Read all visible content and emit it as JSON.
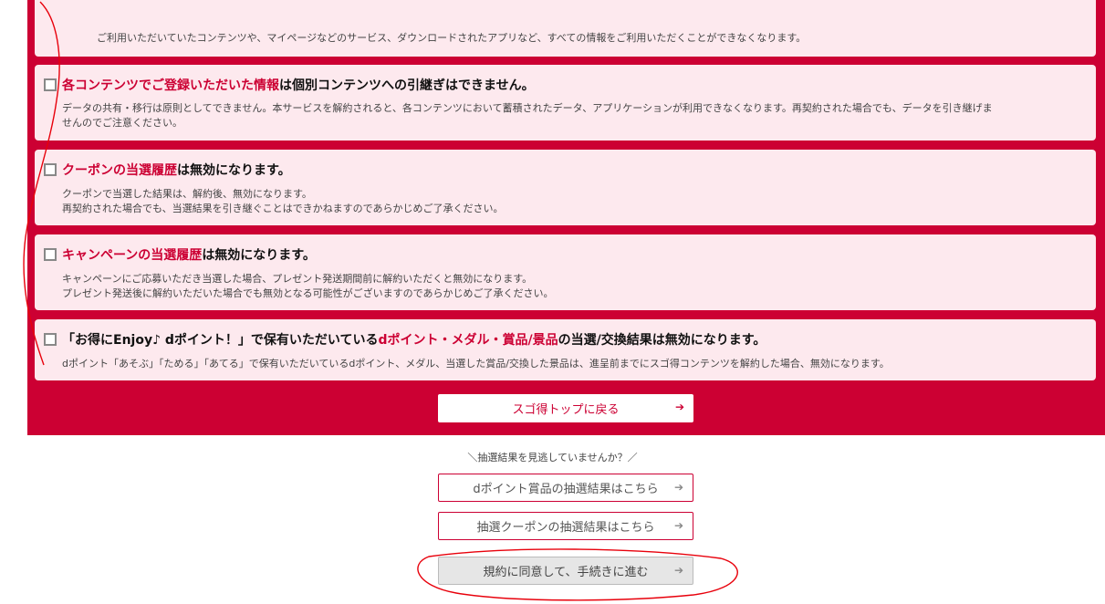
{
  "top_card": {
    "text": "ご利用いただいていたコンテンツや、マイページなどのサービス、ダウンロードされたアプリなど、すべての情報をご利用いただくことができなくなります。"
  },
  "cards": [
    {
      "title_hl": "各コンテンツでご登録いただいた情報",
      "title_rest": "は個別コンテンツへの引継ぎはできません。",
      "body_1": "データの共有・移行は原則としてできません。本サービスを解約されると、各コンテンツにおいて蓄積されたデータ、アプリケーションが利用できなくなります。再契約された場合でも、データを引き継げま",
      "body_2": "せんのでご注意ください。"
    },
    {
      "title_hl": "クーポンの当選履歴",
      "title_rest": "は無効になります。",
      "body_1": "クーポンで当選した結果は、解約後、無効になります。",
      "body_2": "再契約された場合でも、当選結果を引き継ぐことはできかねますのであらかじめご了承ください。"
    },
    {
      "title_hl": "キャンペーンの当選履歴",
      "title_rest": "は無効になります。",
      "body_1": "キャンペーンにご応募いただき当選した場合、プレゼント発送期間前に解約いただくと無効になります。",
      "body_2": "プレゼント発送後に解約いただいた場合でも無効となる可能性がございますのであらかじめご了承ください。"
    },
    {
      "title_pre": "「お得にEnjoy♪ dポイント！」で保有いただいている ",
      "title_hl": "dポイント・メダル・賞品/景品",
      "title_rest": "の当選/交換結果は無効になります。",
      "body_1": "dポイント「あそぶ」「ためる」「あてる」で保有いただいているdポイント、メダル、当選した賞品/交換した景品は、進呈前までにスゴ得コンテンツを解約した場合、無効になります。"
    }
  ],
  "buttons": {
    "back_top": "スゴ得トップに戻る",
    "notice": "＼抽選結果を見逃していませんか？／",
    "dpoint_results": "dポイント賞品の抽選結果はこちら",
    "coupon_results": "抽選クーポンの抽選結果はこちら",
    "agree_proceed": "規約に同意して、手続きに進む",
    "arrow": "➔"
  },
  "colors": {
    "accent": "#cc0033",
    "card_bg": "#fde9ee",
    "annotation": "#e8000b"
  },
  "icons": [
    "checkbox-icon",
    "arrow-right-icon"
  ]
}
